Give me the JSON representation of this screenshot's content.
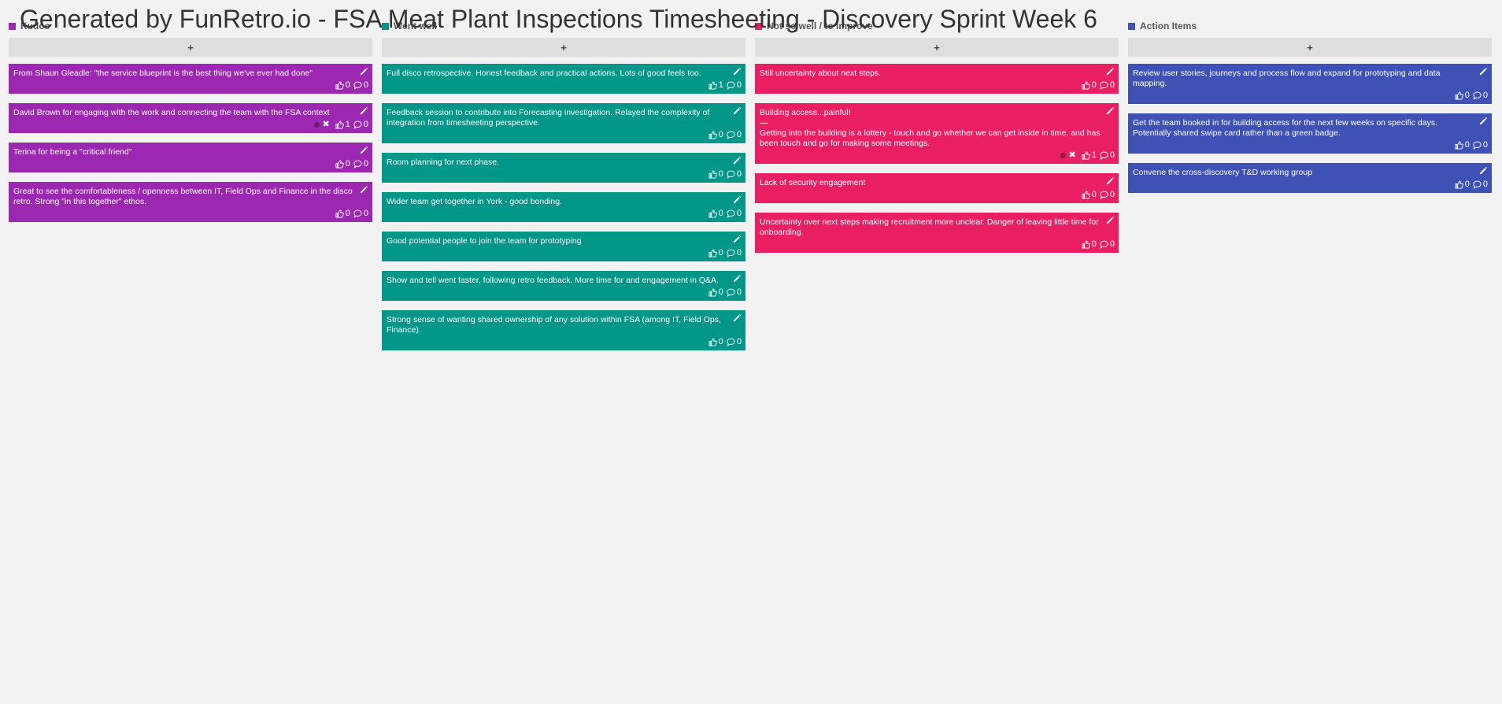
{
  "page_title": "Generated by FunRetro.io - FSA Meat Plant Inspections Timesheeting - Discovery Sprint Week 6",
  "add_label": "+",
  "icons": {
    "edit": "pencil-icon",
    "vote": "thumbs-up-icon",
    "comment": "comment-icon",
    "remove": "close-icon"
  },
  "columns": [
    {
      "title": "Kudos",
      "color": "#9c27b0",
      "cards": [
        {
          "text": "From Shaun Gleadle: \"the service blueprint is the best thing we've ever had done\"",
          "votes": "0",
          "comments": "0"
        },
        {
          "text": "David Brown for engaging with the work and connecting the team with the FSA context",
          "votes": "1",
          "comments": "0",
          "voted": true
        },
        {
          "text": "Terina for being a \"critical friend\"",
          "votes": "0",
          "comments": "0"
        },
        {
          "text": "Great to see the comfortableness / openness between IT, Field Ops and Finance in the disco retro. Strong \"in this together\" ethos.",
          "votes": "0",
          "comments": "0"
        }
      ]
    },
    {
      "title": "Went well",
      "color": "#009688",
      "cards": [
        {
          "text": "Full disco retrospective. Honest feedback and practical actions. Lots of good feels too.",
          "votes": "1",
          "comments": "0"
        },
        {
          "text": "Feedback session to contribute into Forecasting investigation. Relayed the complexity of integration from timesheeting perspective.",
          "votes": "0",
          "comments": "0"
        },
        {
          "text": "Room planning for next phase.",
          "votes": "0",
          "comments": "0"
        },
        {
          "text": "Wider team get together in York - good bonding.",
          "votes": "0",
          "comments": "0"
        },
        {
          "text": "Good potential people to join the team for prototyping",
          "votes": "0",
          "comments": "0"
        },
        {
          "text": "Show and tell went faster, following retro feedback. More time for and engagement in Q&A.",
          "votes": "0",
          "comments": "0"
        },
        {
          "text": "Strong sense of wanting shared ownership of any solution within FSA (among IT, Field Ops, Finance).",
          "votes": "0",
          "comments": "0"
        }
      ]
    },
    {
      "title": "Not so well / to improve",
      "color": "#e91e63",
      "cards": [
        {
          "text": "Still uncertainty about next steps.",
          "votes": "0",
          "comments": "0"
        },
        {
          "text": "Building access...painful!\n—\nGetting into the building is a lottery - touch and go whether we can get inside in time, and has been touch and go for making some meetings.",
          "votes": "1",
          "comments": "0",
          "voted": true
        },
        {
          "text": "Lack of security engagement",
          "votes": "0",
          "comments": "0"
        },
        {
          "text": "Uncertainty over next steps making recruitment more unclear. Danger of leaving little time for onboarding.",
          "votes": "0",
          "comments": "0"
        }
      ]
    },
    {
      "title": "Action Items",
      "color": "#3f51b5",
      "cards": [
        {
          "text": "Review user stories, journeys and process flow and expand for prototyping and data mapping.",
          "votes": "0",
          "comments": "0"
        },
        {
          "text": "Get the team booked in for building access for the next few weeks on specific days. Potentially shared swipe card rather than a green badge.",
          "votes": "0",
          "comments": "0"
        },
        {
          "text": "Convene the cross-discovery T&D working group",
          "votes": "0",
          "comments": "0"
        }
      ]
    }
  ]
}
